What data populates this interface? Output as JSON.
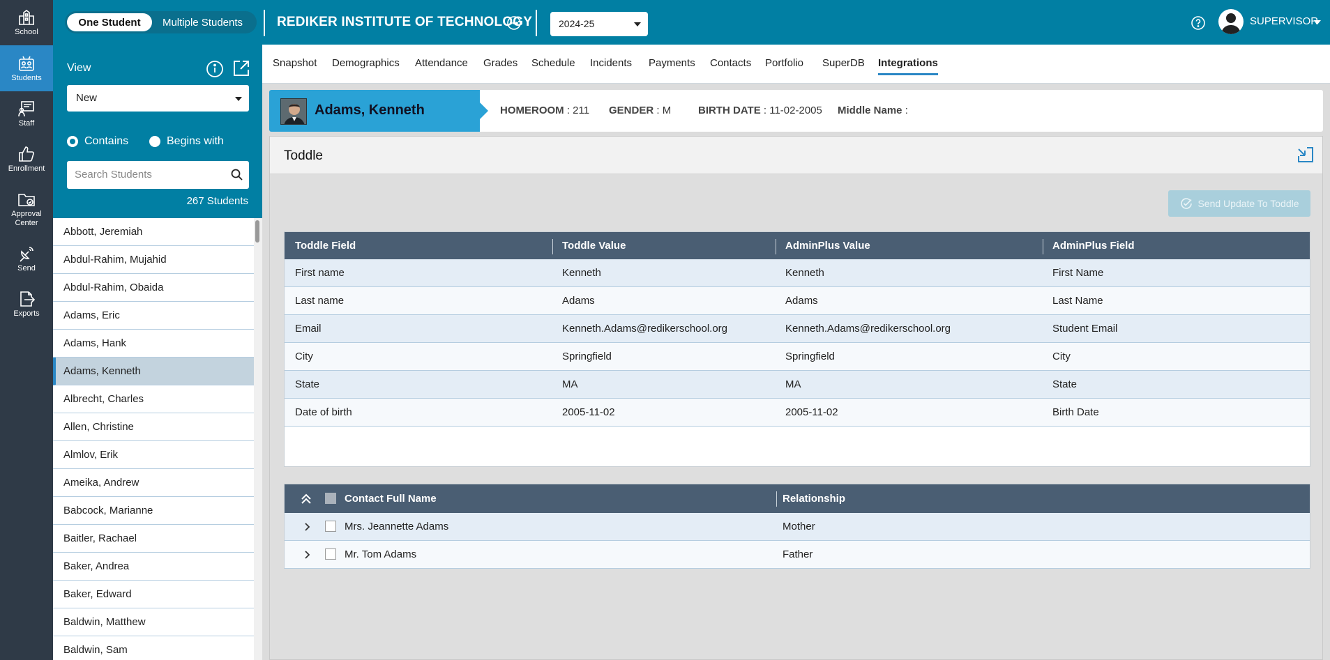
{
  "rail": [
    {
      "label": "School",
      "icon": "school-icon"
    },
    {
      "label": "Students",
      "icon": "students-icon",
      "active": true
    },
    {
      "label": "Staff",
      "icon": "staff-icon"
    },
    {
      "label": "Enrollment",
      "icon": "thumbs-up-icon"
    },
    {
      "label_line1": "Approval",
      "label_line2": "Center",
      "icon": "folder-check-icon"
    },
    {
      "label": "Send",
      "icon": "satellite-icon"
    },
    {
      "label": "Exports",
      "icon": "export-file-icon"
    }
  ],
  "topbar": {
    "mode_one": "One Student",
    "mode_multiple": "Multiple Students",
    "school": "REDIKER INSTITUTE OF TECHNOLOGY",
    "year": "2024-25",
    "user": "SUPERVISOR"
  },
  "panel": {
    "view_label": "View",
    "view_value": "New",
    "contains": "Contains",
    "begins_with": "Begins with",
    "search_placeholder": "Search Students",
    "count": "267 Students"
  },
  "students": [
    "Abbott, Jeremiah",
    "Abdul-Rahim, Mujahid",
    "Abdul-Rahim, Obaida",
    "Adams, Eric",
    "Adams, Hank",
    "Adams, Kenneth",
    "Albrecht, Charles",
    "Allen, Christine",
    "Almlov, Erik",
    "Ameika, Andrew",
    "Babcock, Marianne",
    "Baitler, Rachael",
    "Baker, Andrea",
    "Baker, Edward",
    "Baldwin, Matthew",
    "Baldwin, Sam"
  ],
  "tabs": [
    "Snapshot",
    "Demographics",
    "Attendance",
    "Grades",
    "Schedule",
    "Incidents",
    "Payments",
    "Contacts",
    "Portfolio",
    "SuperDB",
    "Integrations"
  ],
  "banner": {
    "name": "Adams, Kenneth",
    "homeroom_label": "HOMEROOM",
    "homeroom_value": ": 211",
    "gender_label": "GENDER",
    "gender_value": ": M",
    "birth_label": "BIRTH DATE",
    "birth_value": ": 11-02-2005",
    "middle_label": "Middle Name",
    "middle_value": ":"
  },
  "card": {
    "title": "Toddle",
    "send_button": "Send Update To Toddle"
  },
  "field_table": {
    "headers": [
      "Toddle Field",
      "Toddle Value",
      "AdminPlus Value",
      "AdminPlus Field"
    ],
    "rows": [
      [
        "First name",
        "Kenneth",
        "Kenneth",
        "First Name"
      ],
      [
        "Last name",
        "Adams",
        "Adams",
        "Last Name"
      ],
      [
        "Email",
        "Kenneth.Adams@redikerschool.org",
        "Kenneth.Adams@redikerschool.org",
        "Student Email"
      ],
      [
        "City",
        "Springfield",
        "Springfield",
        "City"
      ],
      [
        "State",
        "MA",
        "MA",
        "State"
      ],
      [
        "Date of birth",
        "2005-11-02",
        "2005-11-02",
        "Birth Date"
      ]
    ]
  },
  "contacts_table": {
    "headers": [
      "Contact Full Name",
      "Relationship"
    ],
    "rows": [
      [
        "Mrs. Jeannette Adams",
        "Mother"
      ],
      [
        "Mr. Tom Adams",
        "Father"
      ]
    ]
  }
}
